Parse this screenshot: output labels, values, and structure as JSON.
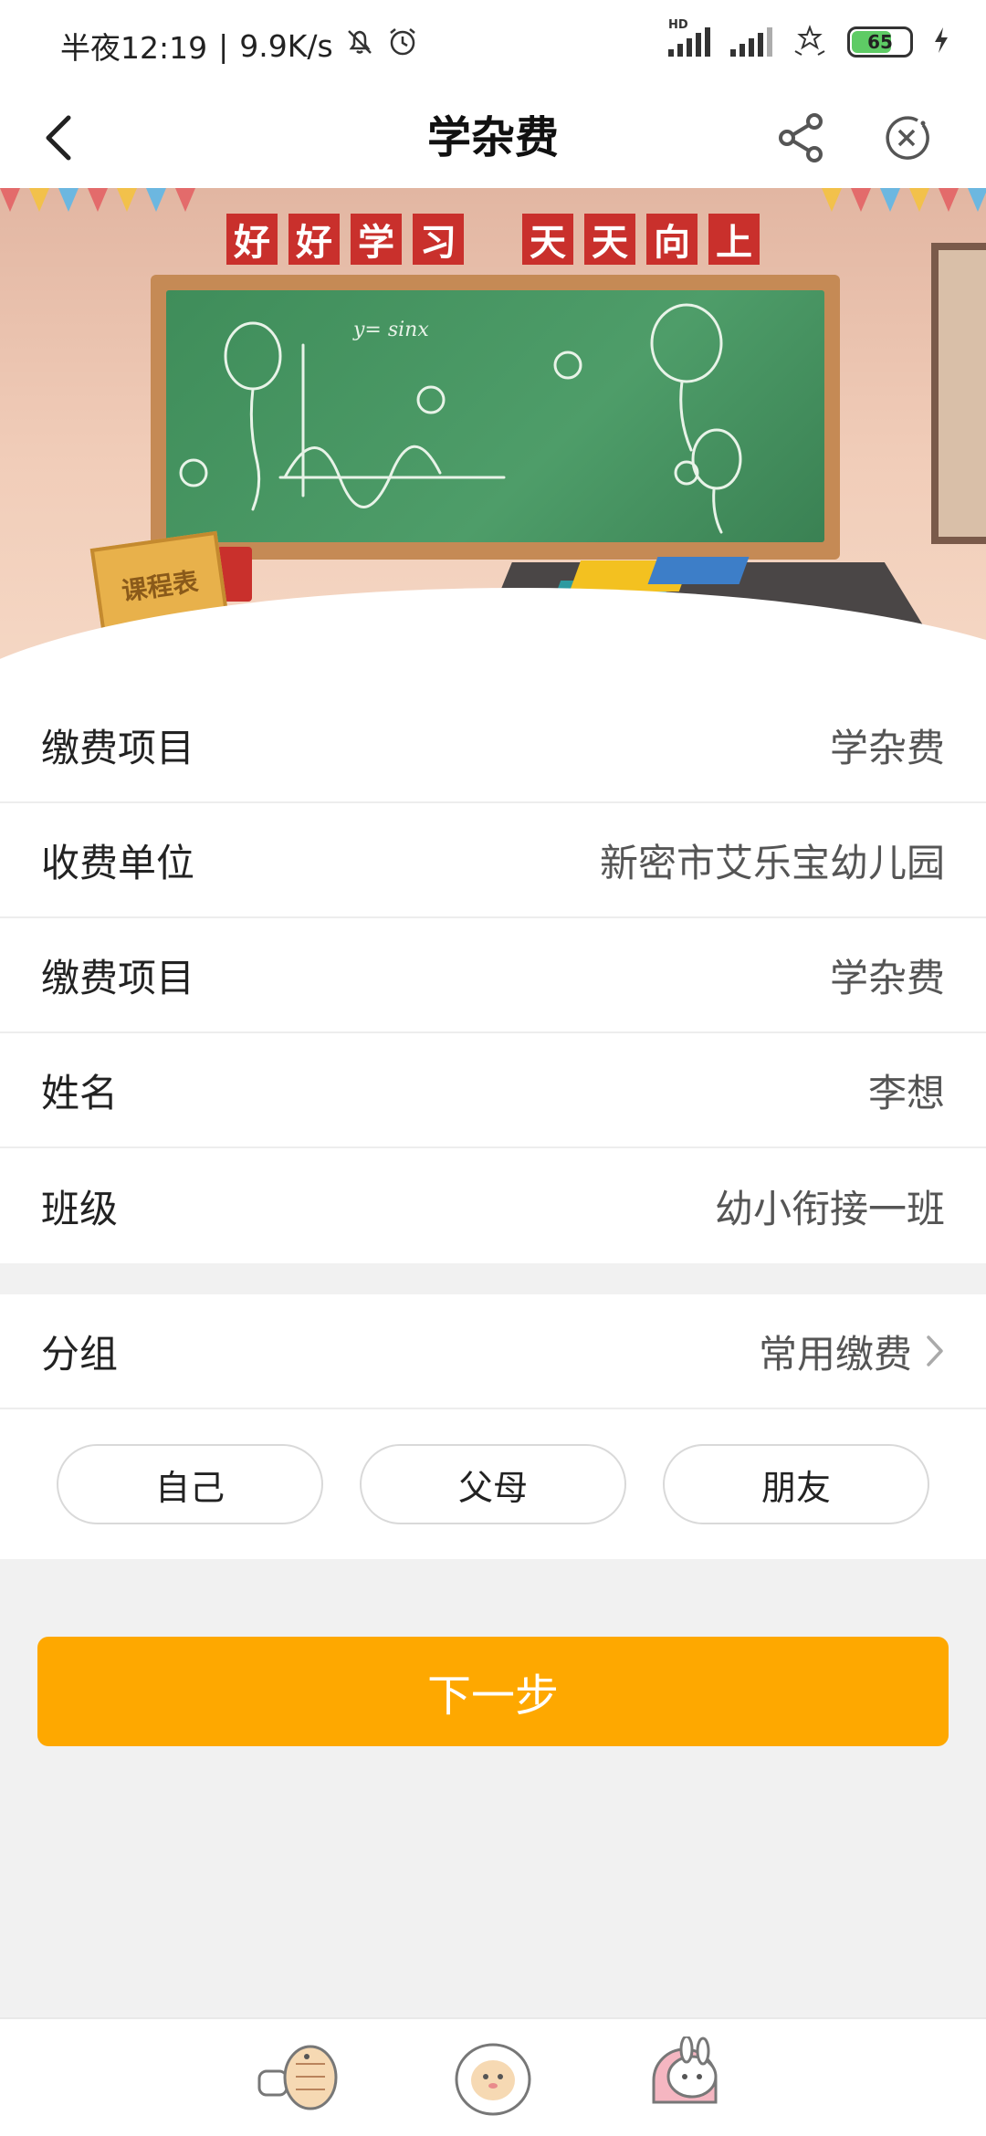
{
  "status_bar": {
    "time": "半夜12:19",
    "speed": "9.9K/s",
    "network_label": "HD",
    "battery": "65"
  },
  "nav": {
    "title": "学杂费"
  },
  "banner": {
    "slogan_part1": [
      "好",
      "好",
      "学",
      "习"
    ],
    "slogan_part2": [
      "天",
      "天",
      "向",
      "上"
    ],
    "board_formula": "y= sinx",
    "sign_text": "课程表"
  },
  "info_rows": [
    {
      "label": "缴费项目",
      "value": "学杂费"
    },
    {
      "label": "收费单位",
      "value": "新密市艾乐宝幼儿园"
    },
    {
      "label": "缴费项目",
      "value": "学杂费"
    },
    {
      "label": "姓名",
      "value": "李想"
    },
    {
      "label": "班级",
      "value": "幼小衔接一班"
    }
  ],
  "group": {
    "label": "分组",
    "value": "常用缴费",
    "chips": [
      "自己",
      "父母",
      "朋友"
    ]
  },
  "next_button": "下一步",
  "colors": {
    "accent": "#fea800",
    "slogan_red": "#c9302c",
    "board_green": "#4e9d69"
  }
}
